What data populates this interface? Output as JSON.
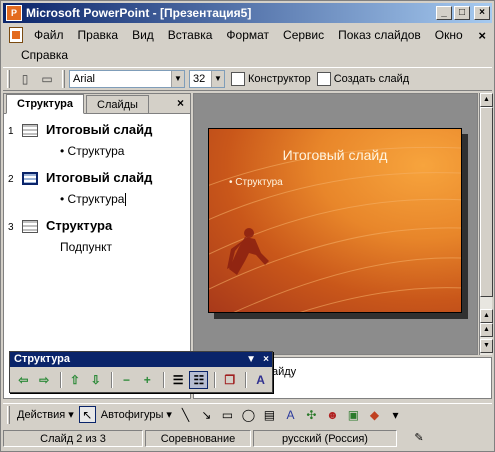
{
  "window": {
    "title": "Microsoft PowerPoint - [Презентация5]",
    "app_icon": "powerpoint-icon",
    "controls": [
      "_",
      "□",
      "×"
    ]
  },
  "menu": {
    "items": [
      "Файл",
      "Правка",
      "Вид",
      "Вставка",
      "Формат",
      "Сервис",
      "Показ слайдов",
      "Окно"
    ],
    "second_row": [
      "Справка"
    ],
    "close_doc": "×"
  },
  "toolbar": {
    "font": "Arial",
    "size": "32",
    "designer": "Конструктор",
    "new_slide": "Создать слайд"
  },
  "outline_pane": {
    "tabs": [
      "Структура",
      "Слайды"
    ],
    "close": "×",
    "slides": [
      {
        "num": "1",
        "title": "Итоговый слайд",
        "bullet": "Структура",
        "has_dot": true
      },
      {
        "num": "2",
        "title": "Итоговый слайд",
        "bullet": "Структура",
        "has_dot": true
      },
      {
        "num": "3",
        "title": "Структура",
        "bullet": "Подпункт",
        "has_dot": false
      }
    ]
  },
  "slide": {
    "title": "Итоговый слайд",
    "bullet": "Структура"
  },
  "notes": {
    "text": "айду"
  },
  "outline_toolbar": {
    "title": "Структура",
    "buttons": [
      "promote-icon",
      "demote-icon",
      "move-up-icon",
      "move-down-icon",
      "collapse-icon",
      "expand-icon",
      "collapse-all-icon",
      "expand-all-icon",
      "summary-slide-icon",
      "show-formatting-icon"
    ]
  },
  "draw_toolbar": {
    "actions": "Действия",
    "autoshapes": "Автофигуры"
  },
  "status": {
    "slide": "Слайд 2 из 3",
    "design": "Соревнование",
    "language": "русский (Россия)"
  },
  "colors": {
    "titlebar": "#0a246a",
    "slide_orange": "#e8862a"
  }
}
